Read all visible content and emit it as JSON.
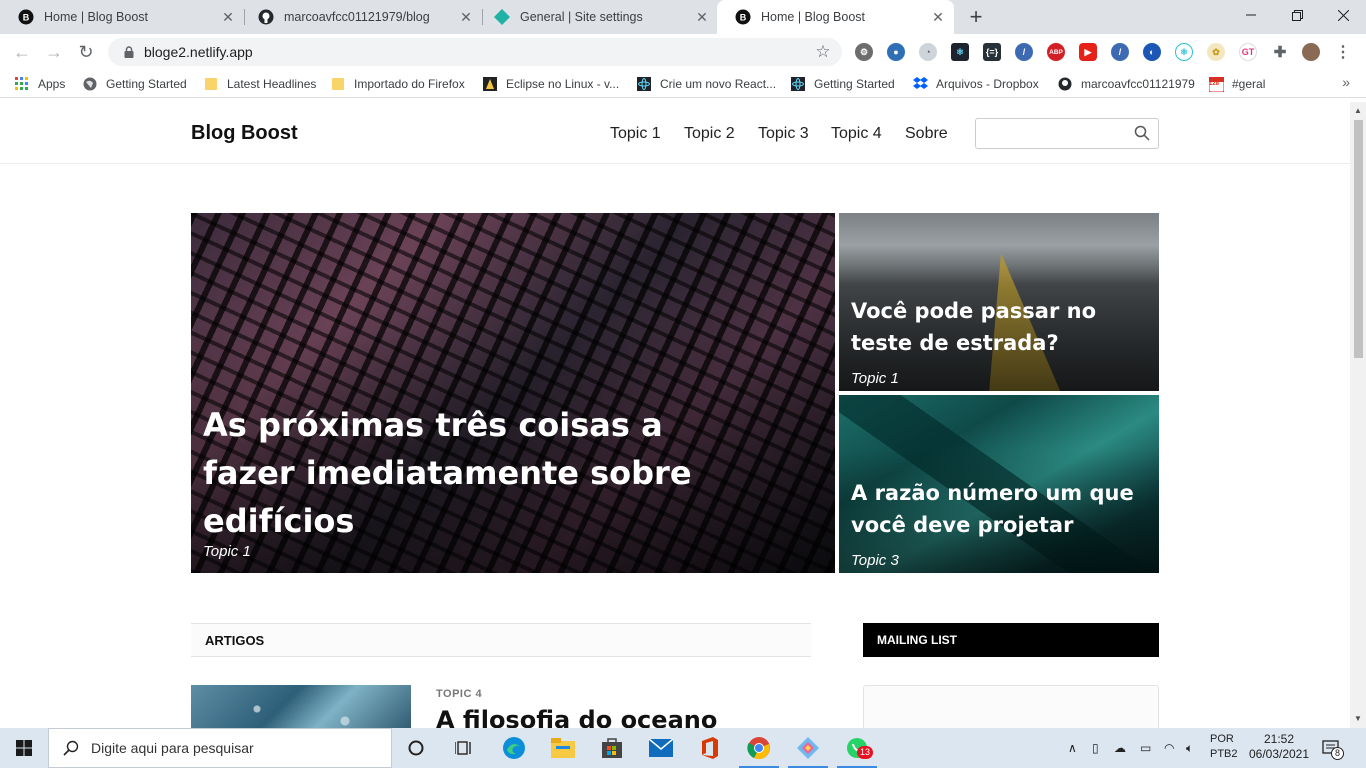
{
  "browser": {
    "tabs": [
      {
        "title": "Home | Blog Boost",
        "favicon": "b-circle-icon"
      },
      {
        "title": "marcoavfcc01121979/blog",
        "favicon": "github-icon"
      },
      {
        "title": "General | Site settings",
        "favicon": "netlify-icon"
      },
      {
        "title": "Home | Blog Boost",
        "favicon": "b-circle-icon",
        "active": true
      }
    ],
    "url": "bloge2.netlify.app",
    "bookmarks": [
      {
        "label": "Apps",
        "icon": "apps-grid-icon"
      },
      {
        "label": "Getting Started",
        "icon": "globe-icon"
      },
      {
        "label": "Latest Headlines",
        "icon": "folder-icon"
      },
      {
        "label": "Importado do Firefox",
        "icon": "folder-icon"
      },
      {
        "label": "Eclipse no Linux - v...",
        "icon": "linux-icon"
      },
      {
        "label": "Crie um novo React...",
        "icon": "react-icon"
      },
      {
        "label": "Getting Started",
        "icon": "react-icon"
      },
      {
        "label": "Arquivos - Dropbox",
        "icon": "dropbox-icon"
      },
      {
        "label": "marcoavfcc01121979",
        "icon": "github-icon"
      },
      {
        "label": "#geral",
        "icon": "calendar-icon"
      }
    ],
    "ext_badges": {
      "abp": "ABP",
      "calendar_num": "128"
    }
  },
  "site": {
    "brand": "Blog Boost",
    "nav": [
      "Topic 1",
      "Topic 2",
      "Topic 3",
      "Topic 4",
      "Sobre"
    ],
    "search_placeholder": "",
    "hero": {
      "main": {
        "title": "As próximas três coisas a fazer imediatamente sobre edifícios",
        "topic": "Topic 1"
      },
      "side1": {
        "title": "Você pode passar no teste de estrada?",
        "topic": "Topic 1"
      },
      "side2": {
        "title": "A razão número um que você deve projetar",
        "topic": "Topic 3"
      }
    },
    "articles_heading": "ARTIGOS",
    "mailing_heading": "MAILING LIST",
    "first_post": {
      "topic": "TOPIC 4",
      "title": "A filosofia do oceano"
    }
  },
  "taskbar": {
    "search_placeholder": "Digite aqui para pesquisar",
    "lang_line1": "POR",
    "lang_line2": "PTB2",
    "time": "21:52",
    "date": "06/03/2021",
    "whatsapp_badge": "13",
    "notif_badge": "8"
  },
  "colors": {
    "accent": "#3d8be0",
    "brand_text": "#111111"
  }
}
